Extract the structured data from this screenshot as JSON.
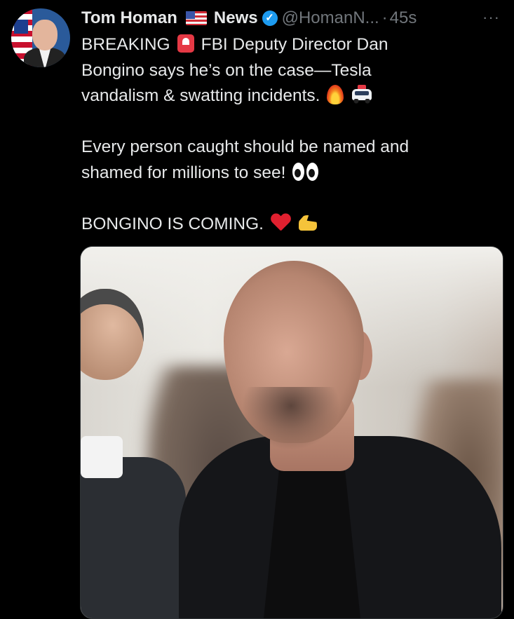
{
  "tweet": {
    "author_name": "Tom Homan",
    "affiliation": "News",
    "handle": "@HomanN...",
    "separator": "·",
    "time": "45s",
    "more": "···",
    "lines": [
      "BREAKING",
      "FBI Deputy Director Dan",
      "Bongino says he’s on the case—Tesla",
      "vandalism & swatting incidents.",
      "Every person caught should be named and",
      "shamed for millions to see!",
      "BONGINO IS COMING."
    ]
  },
  "icons": {
    "flag": "us-flag-icon",
    "verified": "verified-badge-icon",
    "siren": "siren-icon",
    "fire": "fire-icon",
    "police_car": "police-car-icon",
    "eyes": "eyes-icon",
    "heart": "red-heart-icon",
    "muscle": "flexed-biceps-icon"
  },
  "colors": {
    "background": "#000000",
    "text": "#e7e9ea",
    "secondary": "#71767b",
    "verified": "#1d9bf0"
  }
}
